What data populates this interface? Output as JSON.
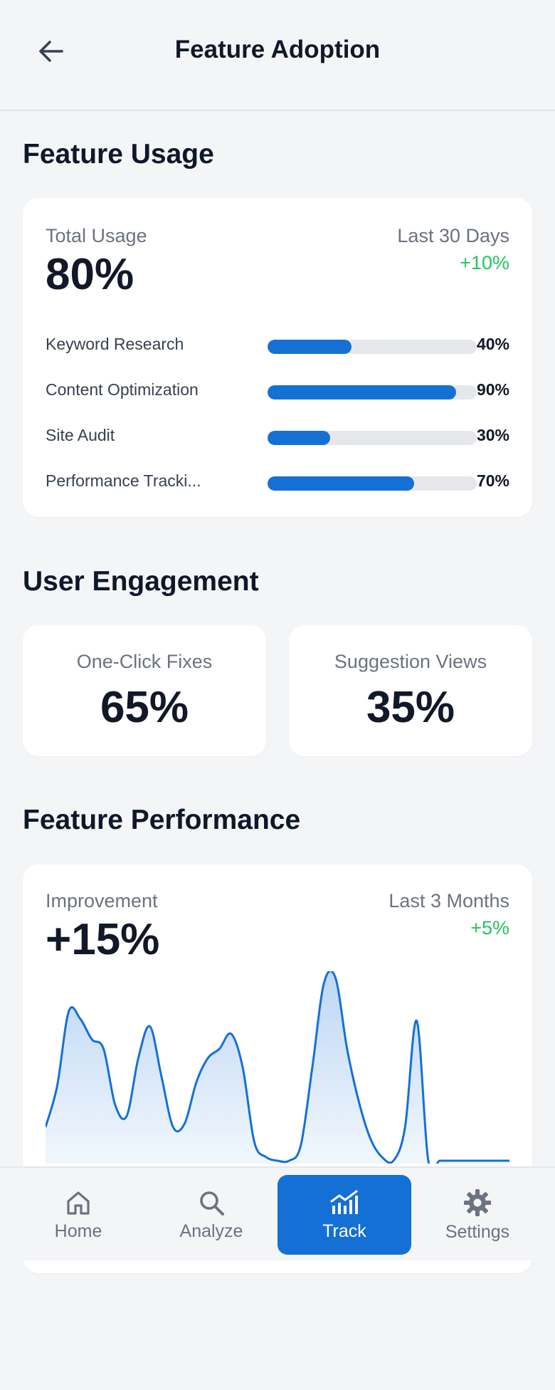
{
  "header": {
    "title": "Feature Adoption",
    "back_icon": "arrow-left-icon"
  },
  "feature_usage": {
    "section_title": "Feature Usage",
    "total_label": "Total Usage",
    "total_value": "80%",
    "period_label": "Last 30 Days",
    "change": "+10%",
    "features": [
      {
        "label": "Keyword Research",
        "value_text": "40%",
        "fraction": 0.4
      },
      {
        "label": "Content Optimization",
        "value_text": "90%",
        "fraction": 0.9
      },
      {
        "label": "Site Audit",
        "value_text": "30%",
        "fraction": 0.3
      },
      {
        "label": "Performance Tracki...",
        "value_text": "70%",
        "fraction": 0.7
      }
    ]
  },
  "user_engagement": {
    "section_title": "User Engagement",
    "one_click_label": "One-Click Fixes",
    "one_click_value": "65%",
    "suggestion_label": "Suggestion Views",
    "suggestion_value": "35%"
  },
  "feature_performance": {
    "section_title": "Feature Performance",
    "improvement_label": "Improvement",
    "improvement_value": "+15%",
    "period_label": "Last 3 Months",
    "change": "+5%"
  },
  "chart_data": {
    "type": "area",
    "title": "",
    "xlabel": "",
    "ylabel": "",
    "grid": false,
    "legend": "none",
    "x": [
      0,
      1,
      2,
      3,
      4,
      5,
      6,
      7,
      8,
      9,
      10,
      11,
      12,
      13,
      14,
      15,
      16,
      17,
      18,
      19,
      20,
      21,
      22,
      23,
      24,
      25,
      26,
      27,
      28,
      29,
      30,
      31,
      32,
      33,
      34,
      35,
      36,
      37,
      38,
      39,
      40
    ],
    "series": [
      {
        "values": [
          18,
          40,
          80,
          76,
          65,
          60,
          30,
          24,
          55,
          72,
          45,
          18,
          20,
          42,
          55,
          60,
          68,
          50,
          10,
          2,
          0,
          0,
          8,
          50,
          95,
          98,
          60,
          32,
          12,
          2,
          0,
          18,
          75,
          0,
          0,
          0,
          0,
          0,
          0,
          0,
          0
        ]
      }
    ],
    "color": "#1570d6"
  },
  "nav": {
    "items": [
      {
        "label": "Home",
        "icon": "home-icon",
        "active": false
      },
      {
        "label": "Analyze",
        "icon": "search-icon",
        "active": false
      },
      {
        "label": "Track",
        "icon": "chart-icon",
        "active": true
      },
      {
        "label": "Settings",
        "icon": "gear-icon",
        "active": false
      }
    ]
  },
  "colors": {
    "accent": "#1570d6",
    "positive": "#22c55e",
    "background": "#f4f5f7"
  }
}
